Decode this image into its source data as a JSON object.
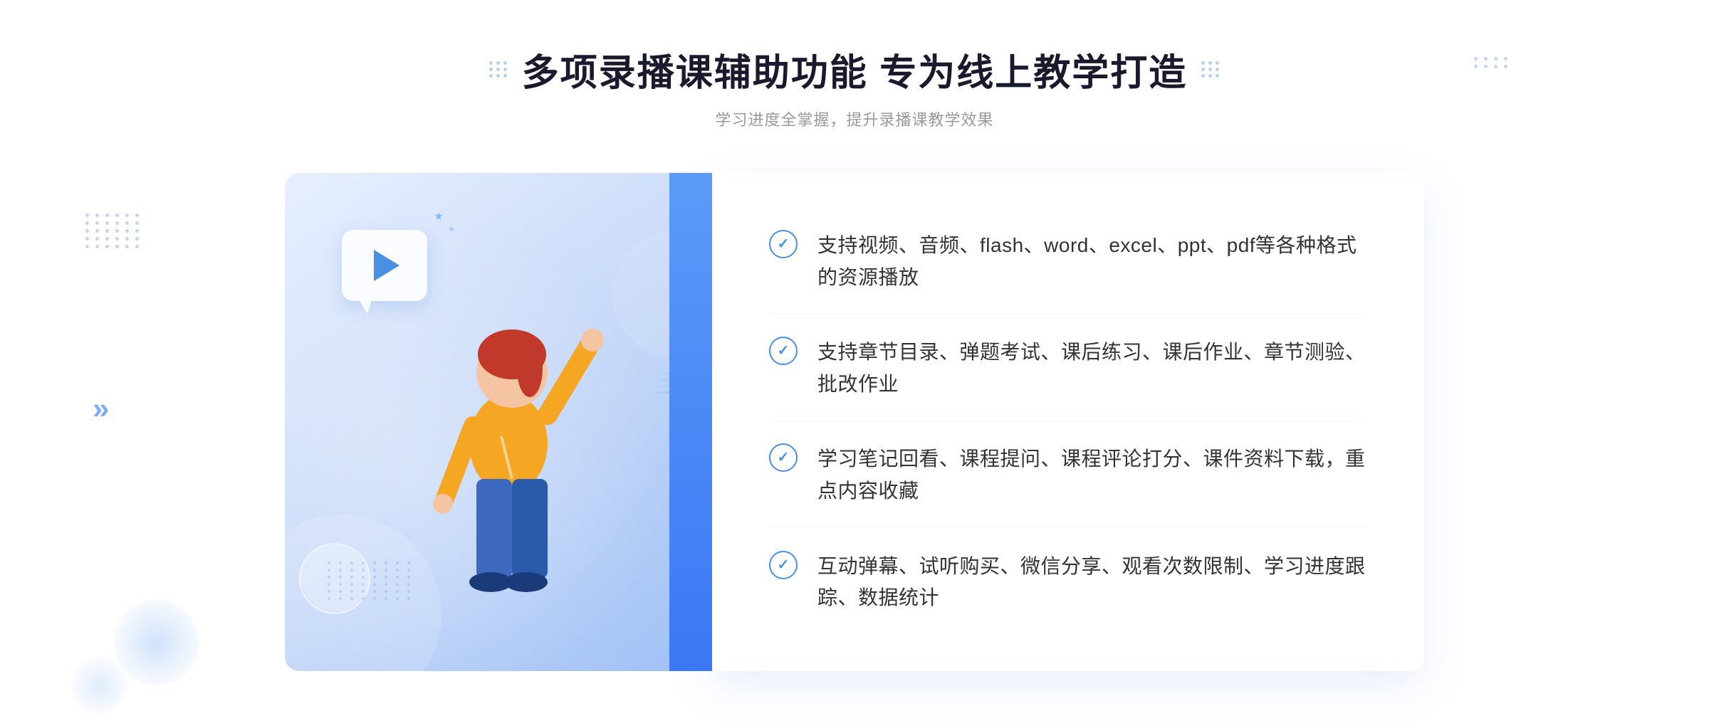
{
  "page": {
    "background": "#ffffff"
  },
  "header": {
    "main_title": "多项录播课辅助功能 专为线上教学打造",
    "subtitle": "学习进度全掌握，提升录播课教学效果"
  },
  "features": [
    {
      "id": 1,
      "text": "支持视频、音频、flash、word、excel、ppt、pdf等各种格式的资源播放"
    },
    {
      "id": 2,
      "text": "支持章节目录、弹题考试、课后练习、课后作业、章节测验、批改作业"
    },
    {
      "id": 3,
      "text": "学习笔记回看、课程提问、课程评论打分、课件资料下载，重点内容收藏"
    },
    {
      "id": 4,
      "text": "互动弹幕、试听购买、微信分享、观看次数限制、学习进度跟踪、数据统计"
    }
  ],
  "colors": {
    "primary": "#4a90e2",
    "primary_dark": "#3a78f5",
    "title": "#1a1a2e",
    "text": "#333333",
    "subtitle": "#999999",
    "border": "#f0f4ff",
    "bg_gradient_start": "#e8f0fe",
    "bg_gradient_end": "#a0c0f5"
  },
  "icons": {
    "check": "✓",
    "play": "▶",
    "double_chevron": "»"
  }
}
